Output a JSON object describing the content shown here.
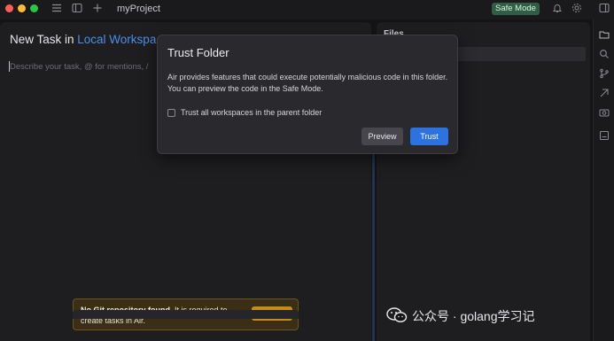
{
  "titlebar": {
    "project_name": "myProject",
    "safe_mode_label": "Safe Mode",
    "icons": [
      "sidebar-toggle-icon",
      "panel-layout-icon",
      "plus-icon",
      "bell-icon",
      "gear-icon",
      "split-view-icon"
    ]
  },
  "task_panel": {
    "title_prefix": "New Task in ",
    "title_link": "Local Workspa",
    "input_placeholder": "Describe your task, @ for mentions, /"
  },
  "git_banner": {
    "message_bold": "No Git repository found.",
    "message_rest": " It is required to create tasks in Air.",
    "initialize_label": "Initialize"
  },
  "files_panel": {
    "title": "Files"
  },
  "dialog": {
    "title": "Trust Folder",
    "body": "Air provides features that could execute potentially malicious code in this folder. You can preview the code in the Safe Mode.",
    "checkbox_label": "Trust all workspaces in the parent folder",
    "checkbox_checked": false,
    "preview_label": "Preview",
    "trust_label": "Trust"
  },
  "right_rail": {
    "icons": [
      "folder-icon",
      "search-icon",
      "git-branch-icon",
      "commit-icon",
      "camera-icon",
      "terminal-icon"
    ]
  },
  "watermark": {
    "text": "公众号 · golang学习记"
  },
  "colors": {
    "accent": "#2c73e0",
    "link": "#4b8fe8",
    "safe_mode": "#2f5e44",
    "warning": "#c58c1a"
  }
}
